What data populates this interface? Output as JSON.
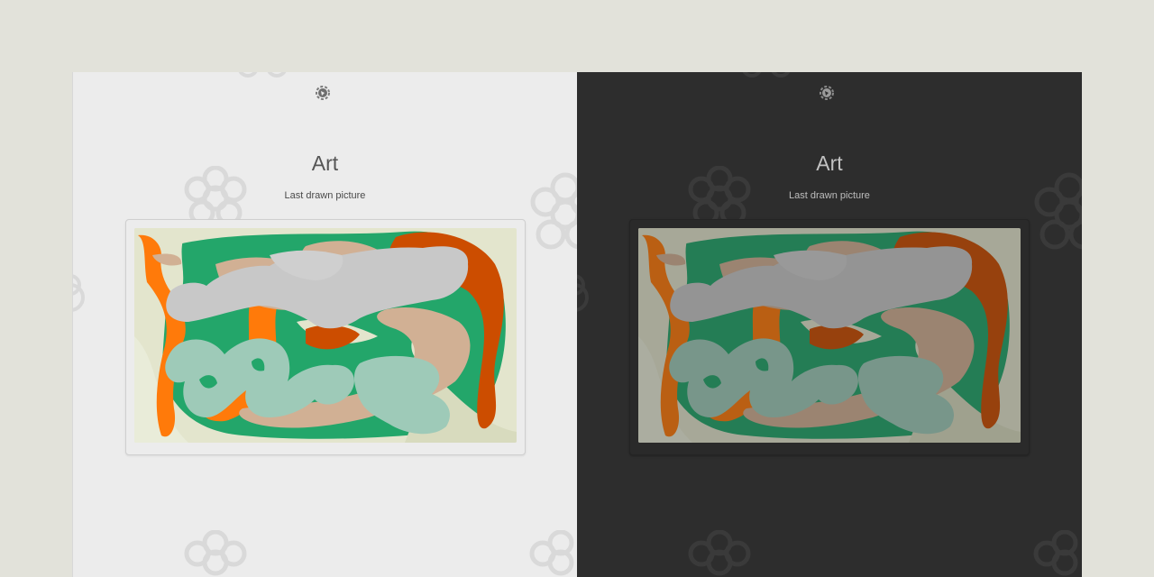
{
  "light": {
    "title": "Art",
    "subtitle": "Last drawn picture"
  },
  "dark": {
    "title": "Art",
    "subtitle": "Last drawn picture"
  },
  "icons": {
    "logo": "settings-gear-logo-icon",
    "decoration": "flower-pattern-icon"
  },
  "colors": {
    "page_background": "#e2e2da",
    "light_panel": "#ececec",
    "dark_panel": "#2d2d2d",
    "art_background": "#e3e5cd",
    "art_green": "#23a66a",
    "art_orange": "#ff7a0a",
    "art_rust": "#cc4d00",
    "art_gray": "#c8c8c8",
    "art_tan": "#d1b094",
    "art_sage": "#9ecab8"
  }
}
